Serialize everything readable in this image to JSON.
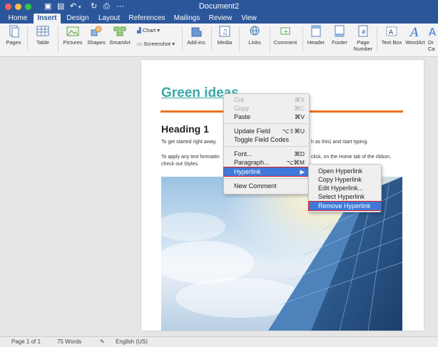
{
  "window": {
    "title": "Document2"
  },
  "tabs": [
    "Home",
    "Insert",
    "Design",
    "Layout",
    "References",
    "Mailings",
    "Review",
    "View"
  ],
  "active_tab": "Insert",
  "ribbon": {
    "pages": "Pages",
    "table": "Table",
    "pictures": "Pictures",
    "shapes": "Shapes",
    "smartart": "SmartArt",
    "chart": "Chart",
    "screenshot": "Screenshot",
    "addins": "Add-ins",
    "media": "Media",
    "links": "Links",
    "comment": "Comment",
    "header": "Header",
    "footer": "Footer",
    "page_number_1": "Page",
    "page_number_2": "Number",
    "textbox": "Text Box",
    "wordart": "WordArt",
    "drop_cap_1": "Dr",
    "drop_cap_2": "Ca"
  },
  "document": {
    "title": "Green ideas",
    "heading": "Heading 1",
    "para1_left": "To get started right away,",
    "para1_right": "h as this) and start typing.",
    "para2_left": "To apply any text formattin",
    "para2_right": "click, on the Home tab of the ribbon,",
    "para2_line2": "check out Styles."
  },
  "context_menu": {
    "items": [
      {
        "label": "Cut",
        "shortcut": "⌘X",
        "disabled": true
      },
      {
        "label": "Copy",
        "shortcut": "⌘C",
        "disabled": true
      },
      {
        "label": "Paste",
        "shortcut": "⌘V",
        "disabled": false
      },
      {
        "label": "Update Field",
        "shortcut": "⌥⇧⌘U",
        "disabled": false
      },
      {
        "label": "Toggle Field Codes",
        "shortcut": "",
        "disabled": false
      },
      {
        "label": "Font...",
        "shortcut": "⌘D",
        "disabled": false
      },
      {
        "label": "Paragraph...",
        "shortcut": "⌥⌘M",
        "disabled": false
      },
      {
        "label": "Hyperlink",
        "shortcut": "▶",
        "disabled": false
      },
      {
        "label": "New Comment",
        "shortcut": "",
        "disabled": false
      }
    ]
  },
  "submenu": {
    "items": [
      "Open Hyperlink",
      "Copy Hyperlink",
      "Edit Hyperlink...",
      "Select Hyperlink",
      "Remove Hyperlink"
    ]
  },
  "status": {
    "page": "Page 1 of 1",
    "words": "75 Words",
    "language": "English (US)"
  },
  "colors": {
    "title_bar": "#2b579a",
    "heading_green": "#3aa6a6",
    "rule_orange": "#e8741f",
    "menu_highlight": "#3f78d8"
  }
}
